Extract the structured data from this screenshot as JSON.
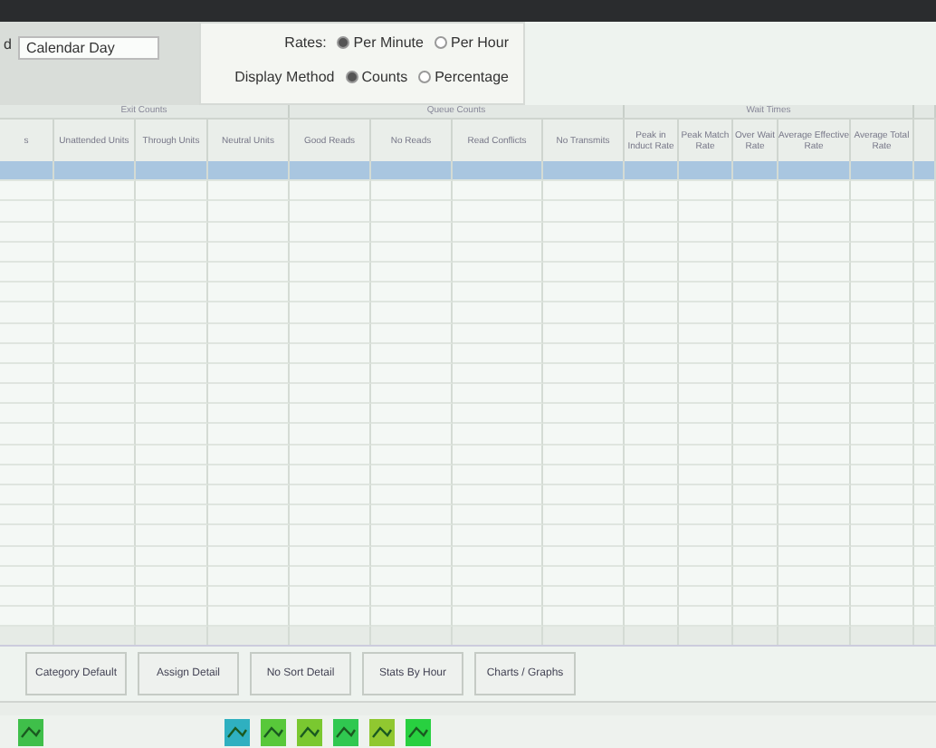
{
  "period": {
    "label": "d",
    "value": "Calendar Day"
  },
  "rates": {
    "label": "Rates:",
    "options": [
      {
        "label": "Per Minute",
        "selected": true
      },
      {
        "label": "Per Hour",
        "selected": false
      }
    ]
  },
  "display_method": {
    "label": "Display Method",
    "options": [
      {
        "label": "Counts",
        "selected": true
      },
      {
        "label": "Percentage",
        "selected": false
      }
    ]
  },
  "table": {
    "groups": [
      "Exit Counts",
      "Queue Counts",
      "Wait Times"
    ],
    "columns": [
      "s",
      "Unattended Units",
      "Through Units",
      "Neutral Units",
      "Good Reads",
      "No Reads",
      "Read Conflicts",
      "No Transmits",
      "Peak in Induct Rate",
      "Peak Match Rate",
      "Over Wait Rate",
      "Average Effective Rate",
      "Average Total Rate"
    ],
    "rows": [
      {
        "selected": true
      },
      {
        "selected": false
      },
      {
        "selected": false
      },
      {
        "selected": false
      },
      {
        "selected": false
      },
      {
        "selected": false
      },
      {
        "selected": false
      },
      {
        "selected": false
      },
      {
        "selected": false
      },
      {
        "selected": false
      },
      {
        "selected": false
      },
      {
        "selected": false
      },
      {
        "selected": false
      },
      {
        "selected": false
      },
      {
        "selected": false
      },
      {
        "selected": false
      },
      {
        "selected": false
      },
      {
        "selected": false
      },
      {
        "selected": false
      },
      {
        "selected": false
      },
      {
        "selected": false
      },
      {
        "selected": false
      },
      {
        "selected": false
      }
    ]
  },
  "buttons": [
    "Category Default",
    "Assign Detail",
    "No Sort Detail",
    "Stats By Hour",
    "Charts / Graphs"
  ],
  "taskbar_icons": [
    {
      "color": "#3fbf4a"
    },
    {
      "color": "#2fb0c0"
    },
    {
      "color": "#58c83a"
    },
    {
      "color": "#7ac830"
    },
    {
      "color": "#30c850"
    },
    {
      "color": "#90c830"
    },
    {
      "color": "#28d040"
    }
  ]
}
